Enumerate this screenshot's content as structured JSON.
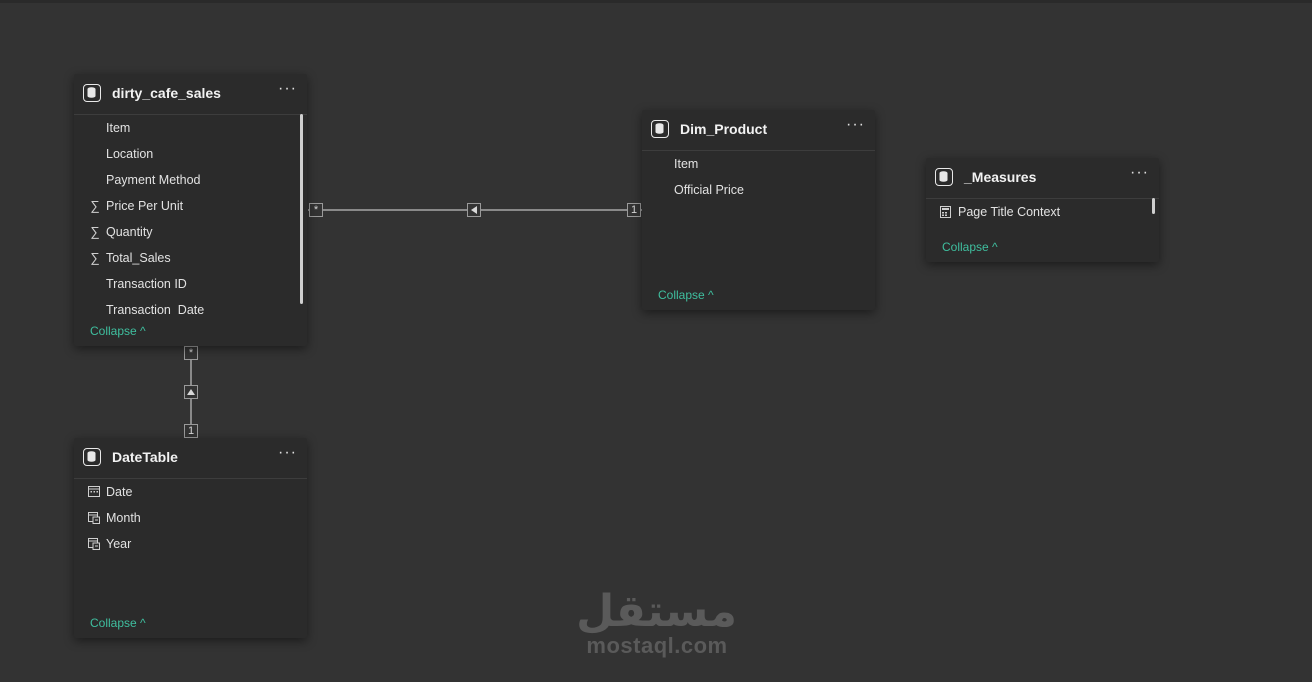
{
  "tables": {
    "dirty_cafe_sales": {
      "title": "dirty_cafe_sales",
      "more": "···",
      "fields": [
        {
          "label": "Item",
          "icon": ""
        },
        {
          "label": "Location",
          "icon": ""
        },
        {
          "label": "Payment Method",
          "icon": ""
        },
        {
          "label": "Price Per Unit",
          "icon": "sigma-icon"
        },
        {
          "label": "Quantity",
          "icon": "sigma-icon"
        },
        {
          "label": "Total_Sales",
          "icon": "sigma-icon"
        },
        {
          "label": "Transaction ID",
          "icon": ""
        },
        {
          "label": "Transaction_Date",
          "icon": ""
        }
      ],
      "collapse": "Collapse"
    },
    "dim_product": {
      "title": "Dim_Product",
      "more": "···",
      "fields": [
        {
          "label": "Item",
          "icon": ""
        },
        {
          "label": "Official Price",
          "icon": ""
        }
      ],
      "collapse": "Collapse"
    },
    "measures": {
      "title": "_Measures",
      "more": "···",
      "fields": [
        {
          "label": "Page Title Context",
          "icon": "calculator-icon"
        }
      ],
      "collapse": "Collapse"
    },
    "datetable": {
      "title": "DateTable",
      "more": "···",
      "fields": [
        {
          "label": "Date",
          "icon": "calendar-icon"
        },
        {
          "label": "Month",
          "icon": "calendar-hierarchy-icon"
        },
        {
          "label": "Year",
          "icon": "calendar-hierarchy-icon"
        }
      ],
      "collapse": "Collapse"
    }
  },
  "relationships": {
    "sales_product": {
      "many": "*",
      "one": "1"
    },
    "sales_date": {
      "many": "*",
      "one": "1"
    }
  },
  "watermark": {
    "arabic": "مستقل",
    "latin": "mostaql.com"
  },
  "colors": {
    "background": "#333333",
    "card": "#2b2b2b",
    "accent": "#3fbf9f"
  }
}
